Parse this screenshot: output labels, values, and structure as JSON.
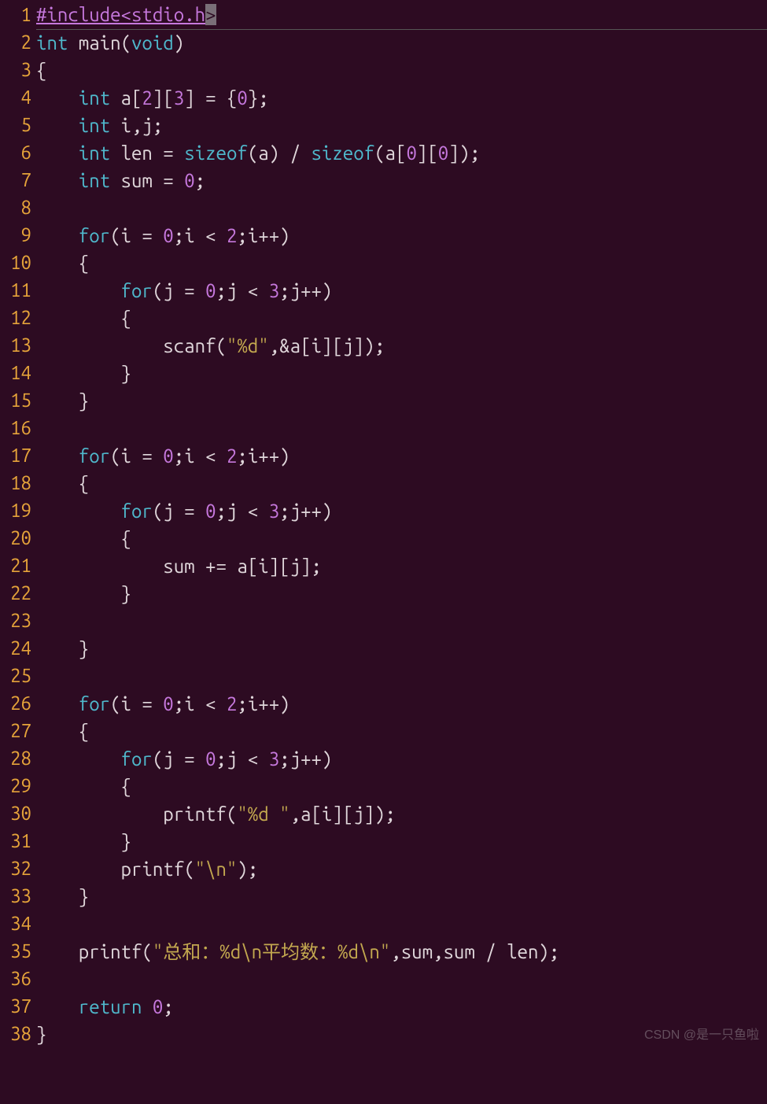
{
  "watermark": "CSDN @是一只鱼啦",
  "lines": [
    {
      "n": "1",
      "tokens": [
        [
          "pre",
          "#include<stdio.h"
        ],
        [
          "cursor",
          ">"
        ]
      ],
      "hl": true
    },
    {
      "n": "2",
      "tokens": [
        [
          "kw",
          "int"
        ],
        [
          "punc",
          " main("
        ],
        [
          "kw",
          "void"
        ],
        [
          "punc",
          ")"
        ]
      ]
    },
    {
      "n": "3",
      "tokens": [
        [
          "punc",
          "{"
        ]
      ]
    },
    {
      "n": "4",
      "tokens": [
        [
          "punc",
          "    "
        ],
        [
          "kw",
          "int"
        ],
        [
          "punc",
          " a["
        ],
        [
          "num",
          "2"
        ],
        [
          "punc",
          "]["
        ],
        [
          "num",
          "3"
        ],
        [
          "punc",
          "] = {"
        ],
        [
          "num",
          "0"
        ],
        [
          "punc",
          "};"
        ]
      ]
    },
    {
      "n": "5",
      "tokens": [
        [
          "punc",
          "    "
        ],
        [
          "kw",
          "int"
        ],
        [
          "punc",
          " i,j;"
        ]
      ]
    },
    {
      "n": "6",
      "tokens": [
        [
          "punc",
          "    "
        ],
        [
          "kw",
          "int"
        ],
        [
          "punc",
          " len = "
        ],
        [
          "kw",
          "sizeof"
        ],
        [
          "punc",
          "(a) / "
        ],
        [
          "kw",
          "sizeof"
        ],
        [
          "punc",
          "(a["
        ],
        [
          "num",
          "0"
        ],
        [
          "punc",
          "]["
        ],
        [
          "num",
          "0"
        ],
        [
          "punc",
          "]);"
        ]
      ]
    },
    {
      "n": "7",
      "tokens": [
        [
          "punc",
          "    "
        ],
        [
          "kw",
          "int"
        ],
        [
          "punc",
          " sum = "
        ],
        [
          "num",
          "0"
        ],
        [
          "punc",
          ";"
        ]
      ]
    },
    {
      "n": "8",
      "tokens": []
    },
    {
      "n": "9",
      "tokens": [
        [
          "punc",
          "    "
        ],
        [
          "kw",
          "for"
        ],
        [
          "punc",
          "(i = "
        ],
        [
          "num",
          "0"
        ],
        [
          "punc",
          ";i < "
        ],
        [
          "num",
          "2"
        ],
        [
          "punc",
          ";i++)"
        ]
      ]
    },
    {
      "n": "10",
      "tokens": [
        [
          "punc",
          "    {"
        ]
      ]
    },
    {
      "n": "11",
      "tokens": [
        [
          "punc",
          "        "
        ],
        [
          "kw",
          "for"
        ],
        [
          "punc",
          "(j = "
        ],
        [
          "num",
          "0"
        ],
        [
          "punc",
          ";j < "
        ],
        [
          "num",
          "3"
        ],
        [
          "punc",
          ";j++)"
        ]
      ]
    },
    {
      "n": "12",
      "tokens": [
        [
          "punc",
          "        {"
        ]
      ]
    },
    {
      "n": "13",
      "tokens": [
        [
          "punc",
          "            scanf("
        ],
        [
          "str",
          "\"%d\""
        ],
        [
          "punc",
          ",&a[i][j]);"
        ]
      ]
    },
    {
      "n": "14",
      "tokens": [
        [
          "punc",
          "        }"
        ]
      ]
    },
    {
      "n": "15",
      "tokens": [
        [
          "punc",
          "    }"
        ]
      ]
    },
    {
      "n": "16",
      "tokens": []
    },
    {
      "n": "17",
      "tokens": [
        [
          "punc",
          "    "
        ],
        [
          "kw",
          "for"
        ],
        [
          "punc",
          "(i = "
        ],
        [
          "num",
          "0"
        ],
        [
          "punc",
          ";i < "
        ],
        [
          "num",
          "2"
        ],
        [
          "punc",
          ";i++)"
        ]
      ]
    },
    {
      "n": "18",
      "tokens": [
        [
          "punc",
          "    {"
        ]
      ]
    },
    {
      "n": "19",
      "tokens": [
        [
          "punc",
          "        "
        ],
        [
          "kw",
          "for"
        ],
        [
          "punc",
          "(j = "
        ],
        [
          "num",
          "0"
        ],
        [
          "punc",
          ";j < "
        ],
        [
          "num",
          "3"
        ],
        [
          "punc",
          ";j++)"
        ]
      ]
    },
    {
      "n": "20",
      "tokens": [
        [
          "punc",
          "        {"
        ]
      ]
    },
    {
      "n": "21",
      "tokens": [
        [
          "punc",
          "            sum += a[i][j];"
        ]
      ]
    },
    {
      "n": "22",
      "tokens": [
        [
          "punc",
          "        }"
        ]
      ]
    },
    {
      "n": "23",
      "tokens": []
    },
    {
      "n": "24",
      "tokens": [
        [
          "punc",
          "    }"
        ]
      ]
    },
    {
      "n": "25",
      "tokens": []
    },
    {
      "n": "26",
      "tokens": [
        [
          "punc",
          "    "
        ],
        [
          "kw",
          "for"
        ],
        [
          "punc",
          "(i = "
        ],
        [
          "num",
          "0"
        ],
        [
          "punc",
          ";i < "
        ],
        [
          "num",
          "2"
        ],
        [
          "punc",
          ";i++)"
        ]
      ]
    },
    {
      "n": "27",
      "tokens": [
        [
          "punc",
          "    {"
        ]
      ]
    },
    {
      "n": "28",
      "tokens": [
        [
          "punc",
          "        "
        ],
        [
          "kw",
          "for"
        ],
        [
          "punc",
          "(j = "
        ],
        [
          "num",
          "0"
        ],
        [
          "punc",
          ";j < "
        ],
        [
          "num",
          "3"
        ],
        [
          "punc",
          ";j++)"
        ]
      ]
    },
    {
      "n": "29",
      "tokens": [
        [
          "punc",
          "        {"
        ]
      ]
    },
    {
      "n": "30",
      "tokens": [
        [
          "punc",
          "            printf("
        ],
        [
          "str",
          "\"%d \""
        ],
        [
          "punc",
          ",a[i][j]);"
        ]
      ]
    },
    {
      "n": "31",
      "tokens": [
        [
          "punc",
          "        }"
        ]
      ]
    },
    {
      "n": "32",
      "tokens": [
        [
          "punc",
          "        printf("
        ],
        [
          "str",
          "\"\\n\""
        ],
        [
          "punc",
          ");"
        ]
      ]
    },
    {
      "n": "33",
      "tokens": [
        [
          "punc",
          "    }"
        ]
      ]
    },
    {
      "n": "34",
      "tokens": []
    },
    {
      "n": "35",
      "tokens": [
        [
          "punc",
          "    printf("
        ],
        [
          "str",
          "\"总和：%d\\n平均数：%d\\n\""
        ],
        [
          "punc",
          ",sum,sum / len);"
        ]
      ]
    },
    {
      "n": "36",
      "tokens": []
    },
    {
      "n": "37",
      "tokens": [
        [
          "punc",
          "    "
        ],
        [
          "kw",
          "return"
        ],
        [
          "punc",
          " "
        ],
        [
          "num",
          "0"
        ],
        [
          "punc",
          ";"
        ]
      ]
    },
    {
      "n": "38",
      "tokens": [
        [
          "punc",
          "}"
        ]
      ]
    }
  ]
}
